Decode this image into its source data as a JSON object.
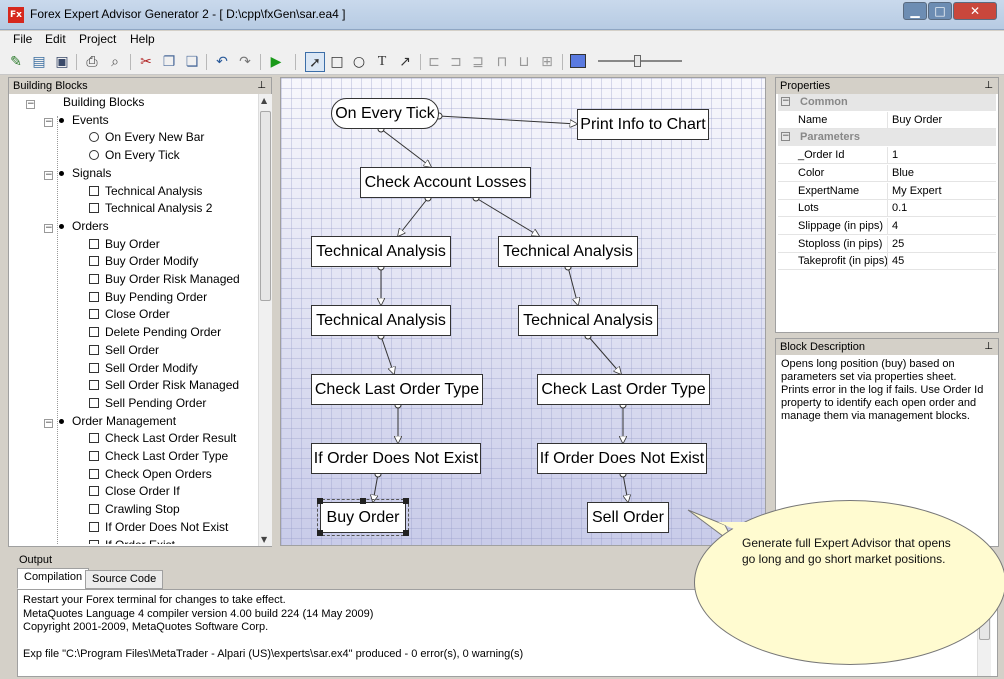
{
  "window": {
    "title": "Forex Expert Advisor Generator 2 - [ D:\\cpp\\fxGen\\sar.ea4 ]",
    "app_icon": "Fx"
  },
  "menu": [
    "File",
    "Edit",
    "Project",
    "Help"
  ],
  "toolbar": {
    "icons": [
      "new-icon",
      "open-icon",
      "save-icon",
      "print-icon",
      "preview-icon",
      "cut-icon",
      "copy-icon",
      "paste-icon",
      "undo-icon",
      "redo-icon",
      "run-icon",
      "pointer-icon",
      "rect-icon",
      "ellipse-icon",
      "text-icon",
      "connector-icon",
      "align-left-icon",
      "align-center-icon",
      "align-right-icon",
      "align-top-icon",
      "align-middle-icon",
      "align-bottom-icon",
      "color-icon",
      "zoom-slider"
    ]
  },
  "building_blocks": {
    "title": "Building Blocks",
    "root": "Building Blocks",
    "groups": [
      {
        "label": "Events",
        "items": [
          "On Every New Bar",
          "On Every Tick"
        ]
      },
      {
        "label": "Signals",
        "items": [
          "Technical Analysis",
          "Technical Analysis 2"
        ]
      },
      {
        "label": "Orders",
        "items": [
          "Buy Order",
          "Buy Order Modify",
          "Buy Order Risk Managed",
          "Buy Pending Order",
          "Close Order",
          "Delete Pending Order",
          "Sell Order",
          "Sell Order Modify",
          "Sell Order Risk Managed",
          "Sell Pending Order"
        ]
      },
      {
        "label": "Order Management",
        "items": [
          "Check Last Order Result",
          "Check Last Order Type",
          "Check Open Orders",
          "Close Order If",
          "Crawling Stop",
          "If Order Does Not Exist",
          "If Order Exist"
        ]
      }
    ]
  },
  "diagram": {
    "blocks": {
      "on_every_tick": "On Every Tick",
      "print_info": "Print Info to Chart",
      "check_account_losses": "Check Account Losses",
      "ta_left_1": "Technical Analysis",
      "ta_right_1": "Technical Analysis",
      "ta_left_2": "Technical Analysis",
      "ta_right_2": "Technical Analysis",
      "check_last_left": "Check Last Order Type",
      "check_last_right": "Check Last Order Type",
      "if_not_exist_left": "If Order Does Not Exist",
      "if_not_exist_right": "If Order Does Not Exist",
      "buy_order": "Buy Order",
      "sell_order": "Sell Order"
    }
  },
  "properties": {
    "title": "Properties",
    "categories": [
      {
        "name": "Common",
        "rows": [
          [
            "Name",
            "Buy Order"
          ]
        ]
      },
      {
        "name": "Parameters",
        "rows": [
          [
            "_Order Id",
            "1"
          ],
          [
            "Color",
            "Blue"
          ],
          [
            "ExpertName",
            "My Expert"
          ],
          [
            "Lots",
            "0.1"
          ],
          [
            "Slippage (in pips)",
            "4"
          ],
          [
            "Stoploss (in pips)",
            "25"
          ],
          [
            "Takeprofit (in pips)",
            "45"
          ]
        ]
      }
    ]
  },
  "block_description": {
    "title": "Block Description",
    "text": "Opens long position (buy) based on parameters set via properties sheet. Prints error in the log if fails. Use Order Id property to identify each open order and manage them via management blocks."
  },
  "output": {
    "title": "Output",
    "tabs": [
      "Compilation",
      "Source Code"
    ],
    "lines": [
      "Restart your Forex terminal for changes to take effect.",
      "MetaQuotes Language 4 compiler version 4.00 build 224 (14 May 2009)",
      "Copyright 2001-2009, MetaQuotes Software Corp.",
      "",
      "Exp file \"C:\\Program Files\\MetaTrader - Alpari (US)\\experts\\sar.ex4\" produced - 0 error(s), 0 warning(s)"
    ]
  },
  "callout": {
    "text": "Generate full Expert Advisor that opens go long and go short market positions."
  }
}
